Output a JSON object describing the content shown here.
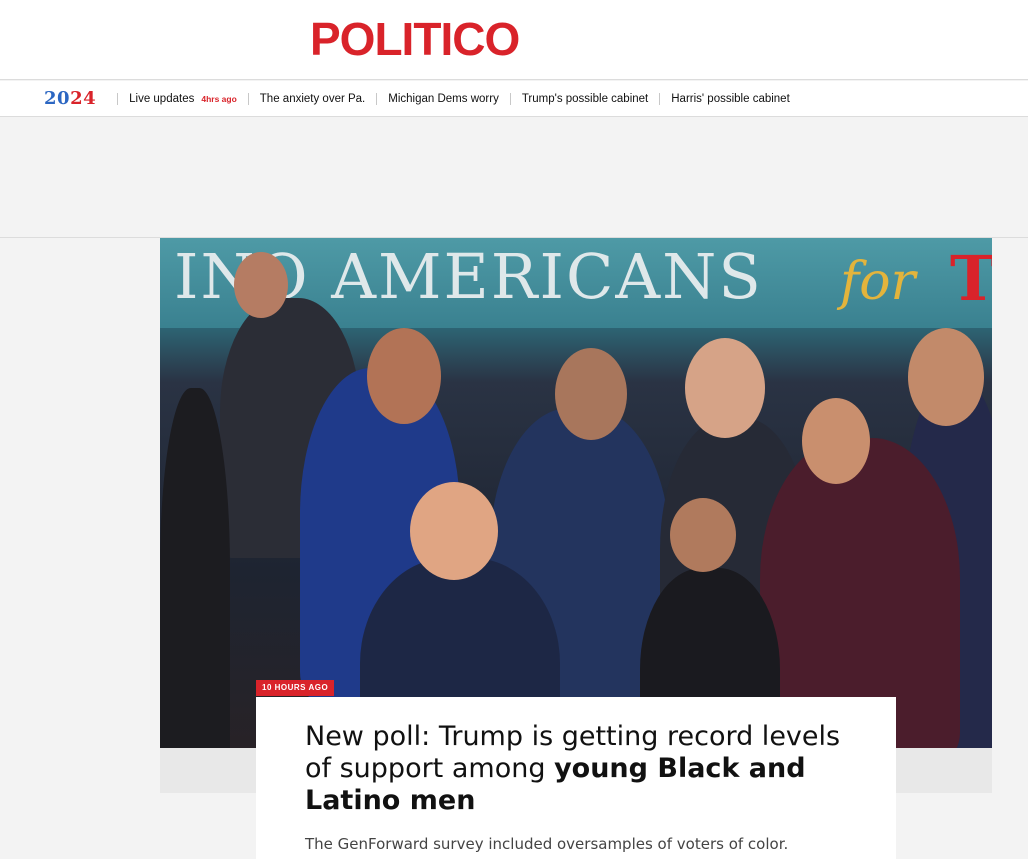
{
  "header": {
    "logo": "POLITICO"
  },
  "nav": {
    "year_part1": "20",
    "year_part2": "24",
    "items": [
      {
        "label": "Live updates",
        "time": "4hrs ago"
      },
      {
        "label": "The anxiety over Pa."
      },
      {
        "label": "Michigan Dems worry"
      },
      {
        "label": "Trump's possible cabinet"
      },
      {
        "label": "Harris' possible cabinet"
      }
    ]
  },
  "hero": {
    "sign_text": "INO AMERICANS",
    "sign_for": "for",
    "sign_t": "T"
  },
  "story": {
    "badge": "10 HOURS AGO",
    "headline_plain": "New poll: Trump is getting record levels of support among ",
    "headline_bold": "young Black and Latino men",
    "dek": "The GenForward survey included oversamples of voters of color."
  },
  "colors": {
    "brand_red": "#d9232a",
    "year_blue": "#2b66c2"
  }
}
